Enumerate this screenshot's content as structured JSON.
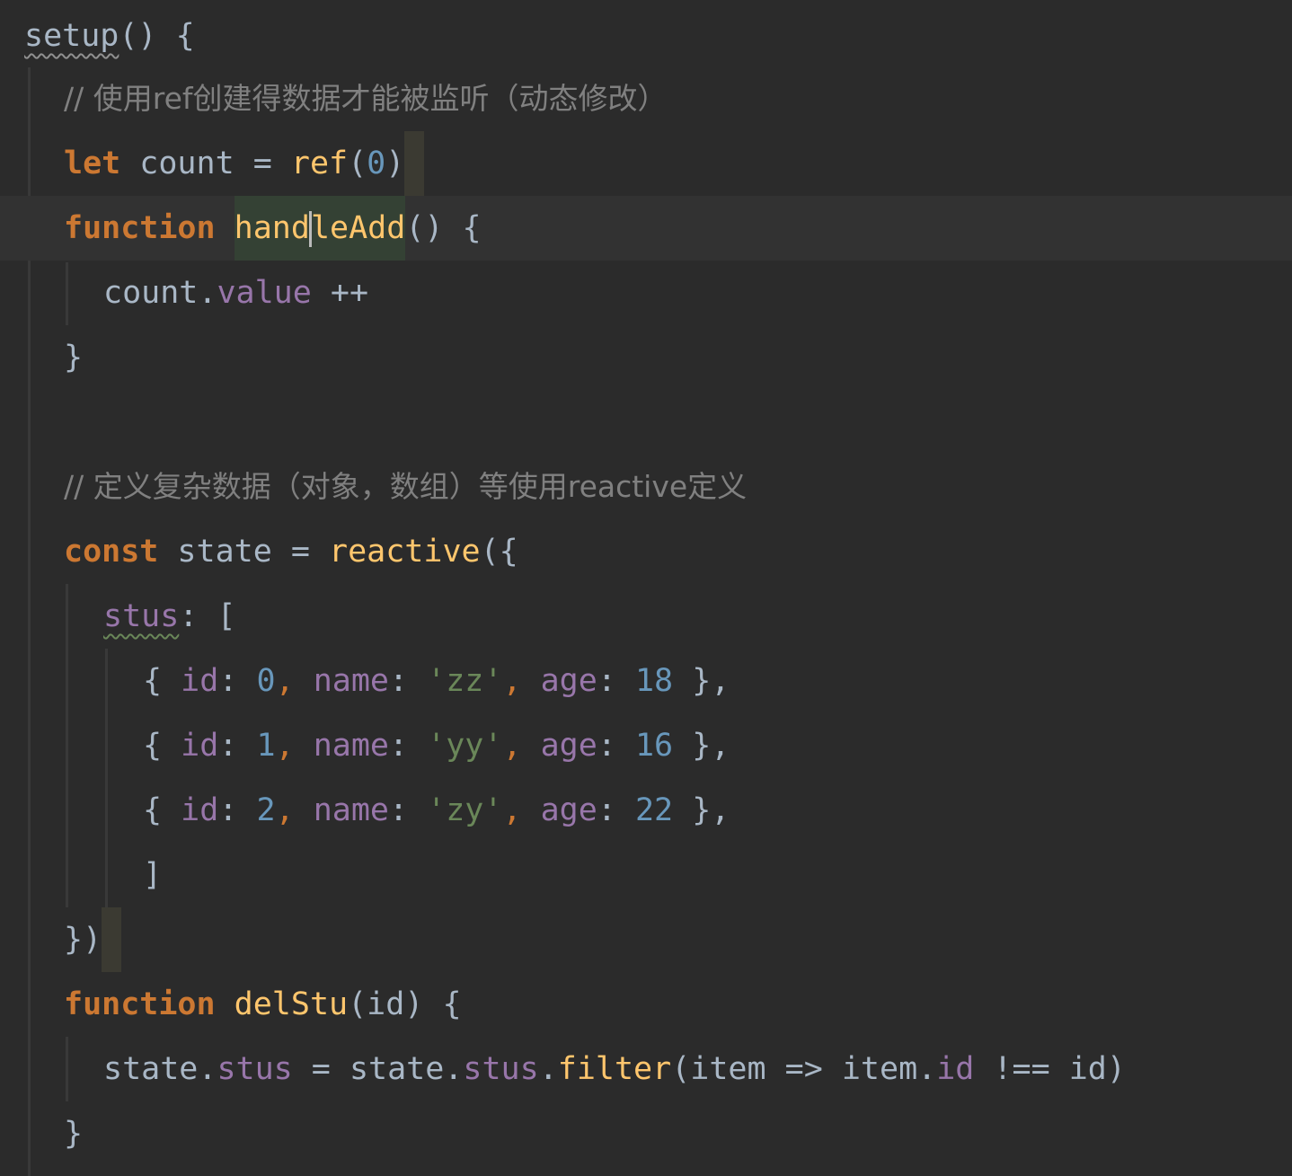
{
  "editor": {
    "theme": {
      "background": "#2b2b2b",
      "keyword": "#cc7832",
      "function": "#ffc66d",
      "number": "#6897bb",
      "string": "#6a8759",
      "property": "#9876aa",
      "comment": "#808080",
      "text": "#a9b7c6"
    },
    "lines": [
      {
        "fn": "setup",
        "rest": "() {"
      },
      {
        "comment": "// 使用ref创建得数据才能被监听（动态修改）"
      },
      {
        "kw": "let",
        "name": " count = ",
        "fn": "ref",
        "open": "(",
        "num": "0",
        "close": ")"
      },
      {
        "kw": "function",
        "fn_a": "hand",
        "fn_b": "leAdd",
        "rest": "() {"
      },
      {
        "obj": "count.",
        "prop": "value",
        "rest": " ++"
      },
      {
        "text": "}"
      },
      {
        "text": ""
      },
      {
        "comment": "// 定义复杂数据（对象，数组）等使用reactive定义"
      },
      {
        "kw": "const",
        "name": " state = ",
        "fn": "reactive",
        "rest": "({"
      },
      {
        "prop": "stus",
        "rest": ": ["
      },
      {
        "id": "0",
        "name": "'zz'",
        "age": "18"
      },
      {
        "id": "1",
        "name": "'yy'",
        "age": "16"
      },
      {
        "id": "2",
        "name": "'zy'",
        "age": "22"
      },
      {
        "text": "]"
      },
      {
        "text_a": "})",
        "text_b": ""
      },
      {
        "kw": "function",
        "fn": "delStu",
        "rest": "(id) {"
      },
      {
        "a": "state.",
        "p1": "stus",
        "b": " = state.",
        "p2": "stus",
        "c": ".",
        "fn": "filter",
        "d": "(item => item.",
        "p3": "id",
        "e": " !== id)"
      },
      {
        "text": "}"
      }
    ],
    "tokens": {
      "id_key": "id",
      "name_key": "name",
      "age_key": "age",
      "colon": ": ",
      "comma": ", ",
      "open_obj": "{ ",
      "close_obj": " },"
    }
  }
}
